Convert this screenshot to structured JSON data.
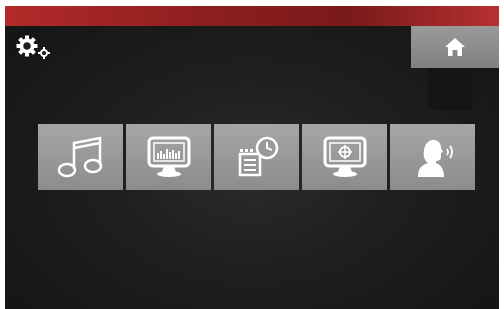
{
  "window": {
    "top_bar_color": "#a32525",
    "background": "#1c1c1c",
    "tile_color": "#999999"
  },
  "header": {
    "settings_icon": "gears-icon",
    "home_icon": "home-icon"
  },
  "tiles": [
    {
      "icon": "music-note-icon"
    },
    {
      "icon": "monitor-equalizer-icon"
    },
    {
      "icon": "film-clock-icon"
    },
    {
      "icon": "monitor-crosshair-icon"
    },
    {
      "icon": "person-speaking-icon"
    }
  ]
}
